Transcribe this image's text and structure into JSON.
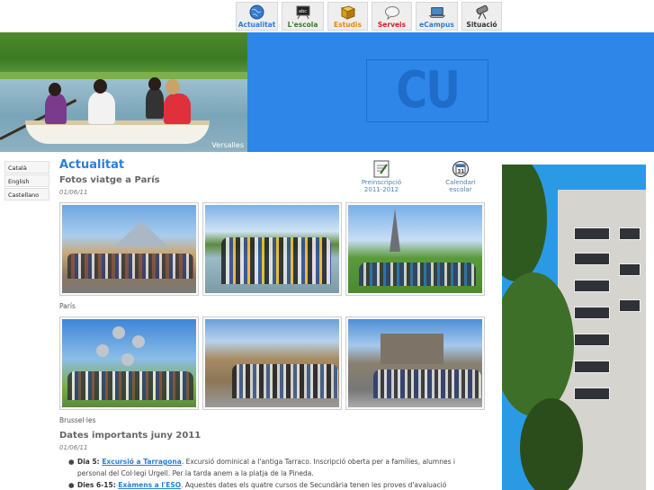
{
  "nav": [
    {
      "label": "Actualitat",
      "icon": "globe-icon",
      "color": "#2a7fd6"
    },
    {
      "label": "L'escola",
      "icon": "chalkboard-icon",
      "color": "#3a7d22"
    },
    {
      "label": "Estudis",
      "icon": "book-icon",
      "color": "#e08a10"
    },
    {
      "label": "Serveis",
      "icon": "speech-bubble-icon",
      "color": "#d42020"
    },
    {
      "label": "eCampus",
      "icon": "laptop-icon",
      "color": "#2a7fd6"
    },
    {
      "label": "Situació",
      "icon": "telescope-icon",
      "color": "#333333"
    }
  ],
  "banner": {
    "photo_caption": "Versalles",
    "logo_text": "CU",
    "bg_color": "#2e86e8"
  },
  "languages": [
    "Català",
    "English",
    "Castellano"
  ],
  "main": {
    "section_title": "Actualitat",
    "quick_links": [
      {
        "label_line1": "Preinscripció",
        "label_line2": "2011-2012",
        "icon": "form-icon"
      },
      {
        "label_line1": "Calendari",
        "label_line2": "escolar",
        "icon": "calendar-icon"
      }
    ],
    "calendar_day": "31",
    "article1": {
      "title": "Fotos viatge a París",
      "date": "01/06/11",
      "gallery1_caption": "París",
      "gallery2_caption": "Brussel·les"
    },
    "article2": {
      "title": "Dates importants juny 2011",
      "date": "01/06/11",
      "items": [
        {
          "prefix": "Dia 5: ",
          "link": "Excursió a Tarragona",
          "text": ". Excursió dominical a l'antiga Tarraco. Inscripció oberta per a famílies, alumnes i personal del Col·legi Urgell. Per la tarda anem a la platja de la Pineda."
        },
        {
          "prefix": "Dies 6-15: ",
          "link": "Exàmens a l'ESO",
          "text": ". Aquestes dates els quatre cursos de Secundària tenen les proves d'avaluació"
        }
      ]
    }
  },
  "colors": {
    "accent": "#2a7fd6",
    "nav_bg": "#eeeeee"
  }
}
